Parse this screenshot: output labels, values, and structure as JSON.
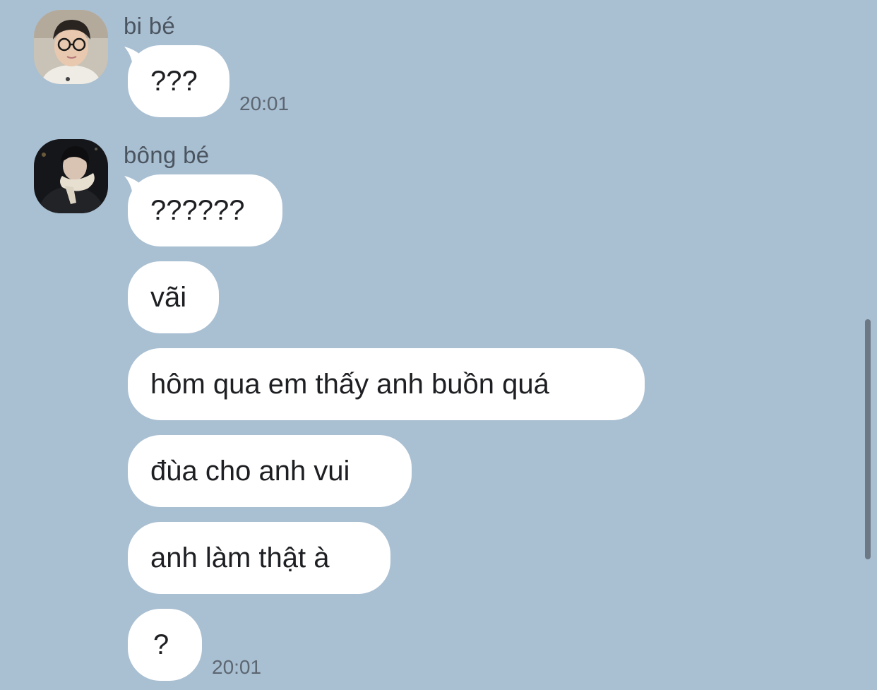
{
  "chat": {
    "groups": [
      {
        "sender": "bi bé",
        "avatar": "avatar-photo-glasses",
        "messages": [
          "???"
        ],
        "time": "20:01"
      },
      {
        "sender": "bông bé",
        "avatar": "avatar-photo-scarf",
        "messages": [
          "??????",
          "vãi",
          "hôm qua em thấy anh buồn quá",
          "đùa cho anh vui",
          "anh làm thật à",
          "?"
        ],
        "time": "20:01"
      }
    ]
  },
  "colors": {
    "background": "#a9bfd2",
    "bubble": "#ffffff",
    "text": "#1e1f22",
    "meta_text": "#5d6772",
    "scrollbar": "#6c7883"
  }
}
